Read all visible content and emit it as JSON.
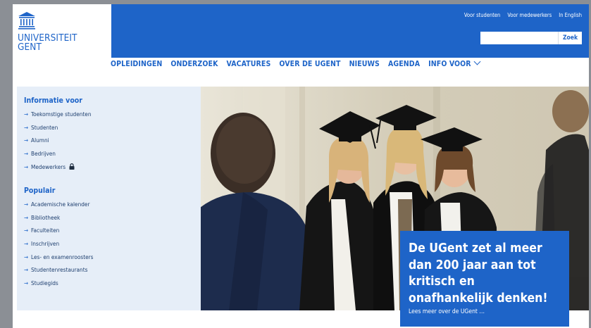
{
  "brand": {
    "line1": "UNIVERSITEIT",
    "line2": "GENT",
    "color": "#1e64c8"
  },
  "top_links": [
    {
      "label": "Voor studenten"
    },
    {
      "label": "Voor medewerkers"
    },
    {
      "label": "In English"
    }
  ],
  "search": {
    "value": "",
    "button_label": "Zoek"
  },
  "main_nav": [
    {
      "label": "OPLEIDINGEN"
    },
    {
      "label": "ONDERZOEK"
    },
    {
      "label": "VACATURES"
    },
    {
      "label": "OVER DE UGENT"
    },
    {
      "label": "NIEUWS"
    },
    {
      "label": "AGENDA"
    },
    {
      "label": "INFO VOOR",
      "icon": "chevron-down-icon"
    }
  ],
  "sidebar": {
    "info": {
      "title": "Informatie voor",
      "items": [
        {
          "label": "Toekomstige studenten"
        },
        {
          "label": "Studenten"
        },
        {
          "label": "Alumni"
        },
        {
          "label": "Bedrijven"
        },
        {
          "label": "Medewerkers",
          "icon": "lock-icon"
        }
      ]
    },
    "popular": {
      "title": "Populair",
      "items": [
        {
          "label": "Academische kalender"
        },
        {
          "label": "Bibliotheek"
        },
        {
          "label": "Faculteiten"
        },
        {
          "label": "Inschrijven"
        },
        {
          "label": "Les- en examenroosters"
        },
        {
          "label": "Studentenrestaurants"
        },
        {
          "label": "Studiegids"
        }
      ]
    },
    "arrow_glyph": "→"
  },
  "hero": {
    "image_icon": "graduation-photo",
    "card": {
      "title": "De UGent zet al meer dan 200 jaar aan tot kritisch en onafhankelijk denken!",
      "link": "Lees meer over de UGent …"
    }
  }
}
